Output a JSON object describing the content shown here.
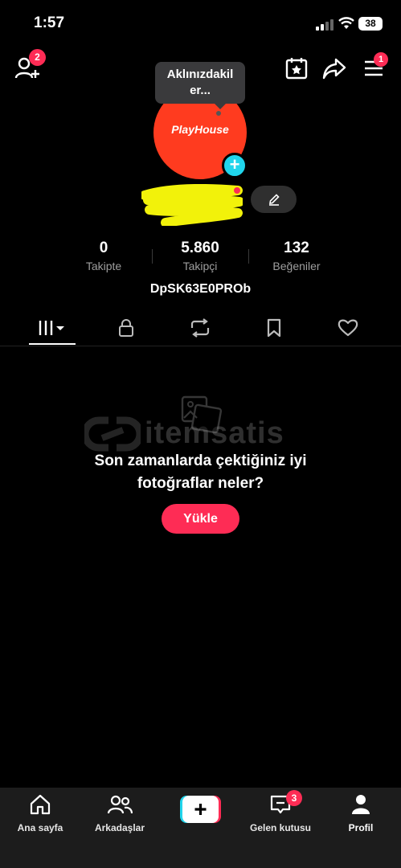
{
  "status_bar": {
    "time": "1:57",
    "battery": "38"
  },
  "top_bar": {
    "add_friends_badge": "2",
    "menu_badge": "1"
  },
  "profile": {
    "tooltip": "Aklınızdakil er...",
    "avatar_text": "PlayHouse",
    "username": "DpSK63E0PROb"
  },
  "stats": [
    {
      "value": "0",
      "label": "Takipte"
    },
    {
      "value": "5.860",
      "label": "Takipçi"
    },
    {
      "value": "132",
      "label": "Beğeniler"
    }
  ],
  "tabs": {
    "icons": [
      "grid-icon",
      "lock-icon",
      "repost-icon",
      "bookmark-icon",
      "heart-icon"
    ]
  },
  "empty_state": {
    "line1": "Son zamanlarda çektiğiniz iyi",
    "line2": "fotoğraflar neler?",
    "button": "Yükle",
    "watermark": "itemsatis"
  },
  "bottom_nav": {
    "home": "Ana sayfa",
    "friends": "Arkadaşlar",
    "inbox": "Gelen kutusu",
    "inbox_badge": "3",
    "profile": "Profil"
  },
  "colors": {
    "accent": "#fe2c55",
    "avatar": "#ff3b1f",
    "cyan": "#20d5ec"
  }
}
